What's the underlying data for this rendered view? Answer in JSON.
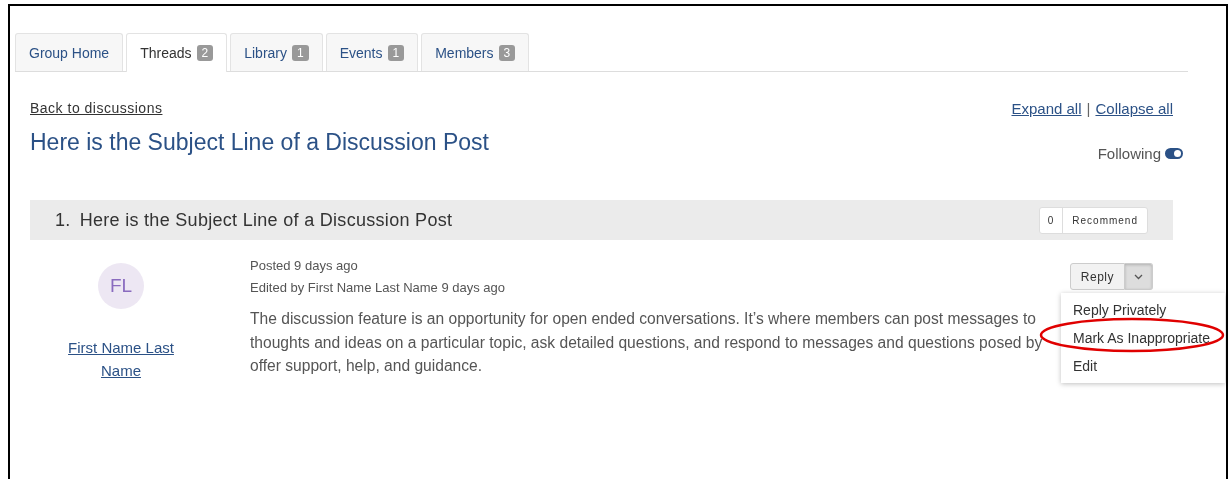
{
  "tabs": [
    {
      "label": "Group Home",
      "selected": false
    },
    {
      "label": "Threads",
      "count": "2",
      "selected": true
    },
    {
      "label": "Library",
      "count": "1",
      "selected": false
    },
    {
      "label": "Events",
      "count": "1",
      "selected": false
    },
    {
      "label": "Members",
      "count": "3",
      "selected": false
    }
  ],
  "back_link": "Back to discussions",
  "expand_all": "Expand all",
  "separator": "|",
  "collapse_all": "Collapse all",
  "title": "Here is the Subject Line of a Discussion Post",
  "following": {
    "label": "Following",
    "on": true
  },
  "thread": {
    "number": "1.",
    "subject": "Here is the Subject Line of a Discussion Post",
    "recommend_count": "0",
    "recommend_label": "Recommend"
  },
  "post": {
    "initials": "FL",
    "author": "First Name Last Name",
    "posted": "Posted 9 days ago",
    "edited": "Edited by First Name Last Name 9 days ago",
    "body_lines": [
      "The discussion feature is an opportunity for open ended conversations. It’s where members can post messages to",
      "thoughts and ideas on a particular topic, ask detailed questions, and respond to messages and questions posed by",
      "offer support, help, and guidance."
    ],
    "reply_label": "Reply",
    "menu_open": true,
    "menu": [
      {
        "label": "Reply Privately",
        "highlighted": false
      },
      {
        "label": "Mark As Inappropriate",
        "highlighted": true
      },
      {
        "label": "Edit",
        "highlighted": false
      }
    ]
  }
}
